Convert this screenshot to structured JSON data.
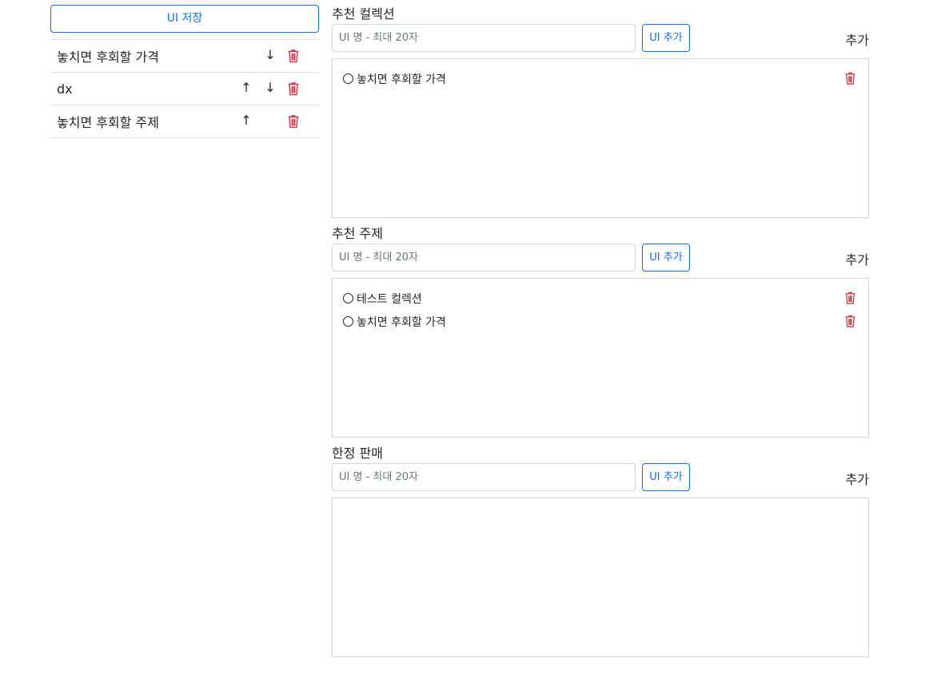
{
  "left": {
    "save_label": "UI 저장",
    "items": [
      {
        "name": "놓치면 후회할 가격",
        "up": "",
        "down": "↓"
      },
      {
        "name": "dx",
        "up": "↑",
        "down": "↓"
      },
      {
        "name": "놓치면 후회할 주제",
        "up": "↑",
        "down": ""
      }
    ]
  },
  "sections": [
    {
      "title": "추천 컬렉션",
      "placeholder": "UI 명 - 최대 20자",
      "add_ui_label": "UI 추가",
      "add_label": "추가",
      "items": [
        "놓치면 후회할 가격"
      ]
    },
    {
      "title": "추천 주제",
      "placeholder": "UI 명 - 최대 20자",
      "add_ui_label": "UI 추가",
      "add_label": "추가",
      "items": [
        "테스트 컬렉션",
        "놓치면 후회할 가격"
      ]
    },
    {
      "title": "한정 판매",
      "placeholder": "UI 명 - 최대 20자",
      "add_ui_label": "UI 추가",
      "add_label": "추가",
      "items": []
    }
  ],
  "colors": {
    "accent": "#0d6efd",
    "danger": "#dc3545",
    "border": "#ced4da"
  },
  "icons": {
    "trash": "trash-icon",
    "arrow_up": "arrow-up-icon",
    "arrow_down": "arrow-down-icon"
  }
}
